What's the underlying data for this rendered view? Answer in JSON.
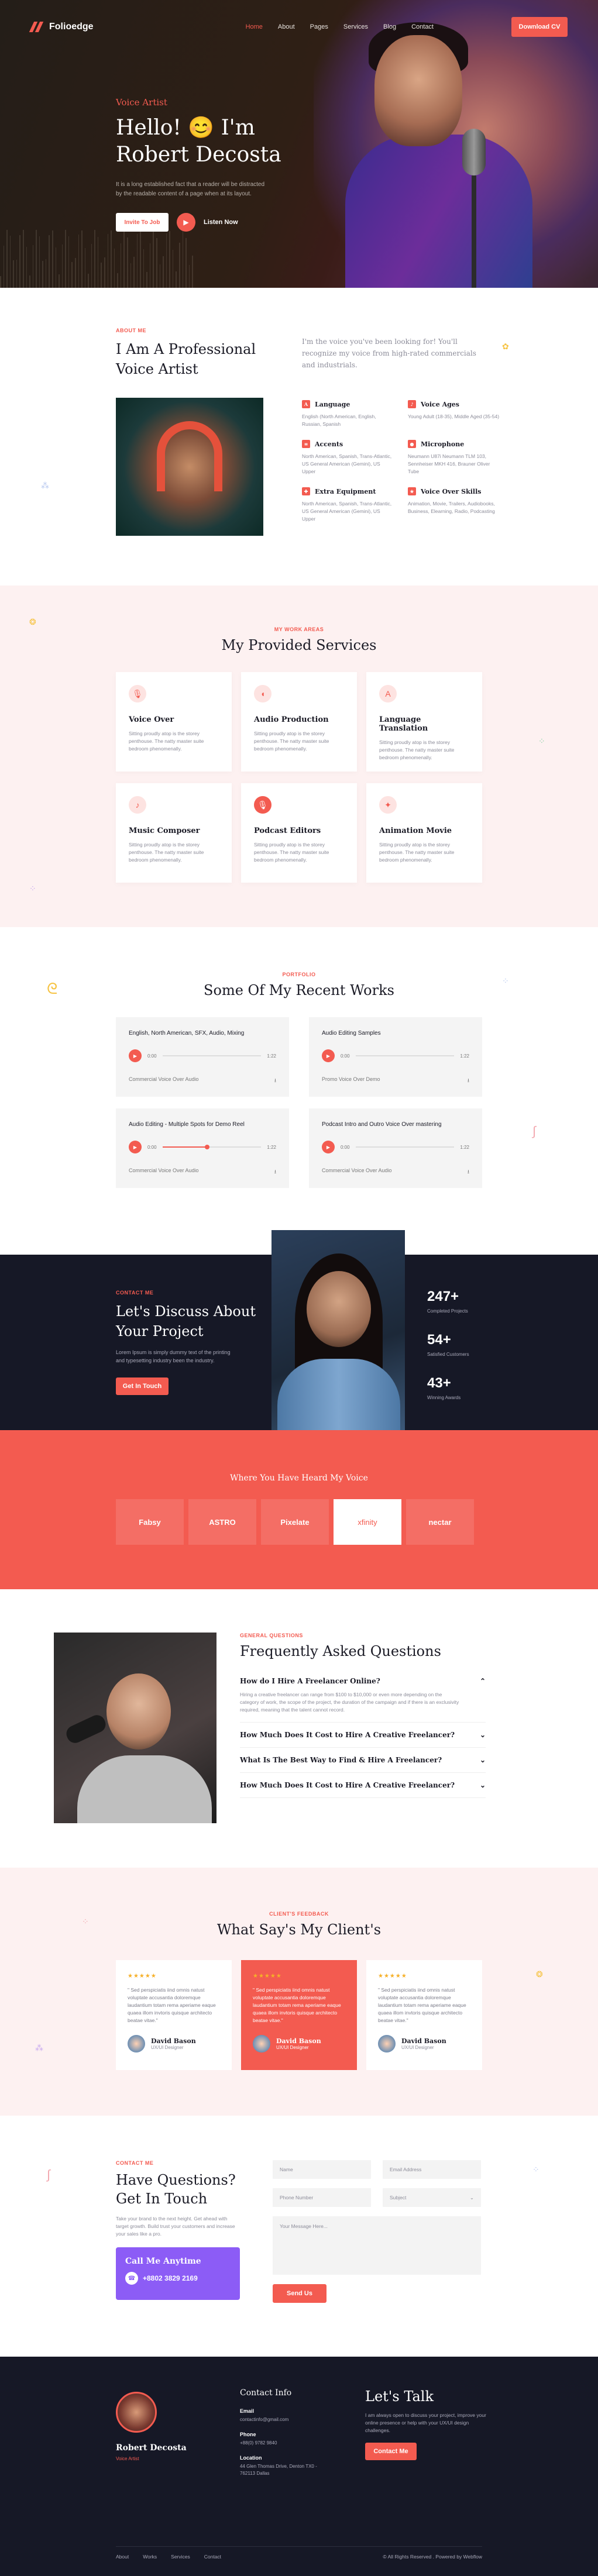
{
  "brand": {
    "name": "Folioedge"
  },
  "nav": {
    "items": [
      {
        "label": "Home"
      },
      {
        "label": "About"
      },
      {
        "label": "Pages"
      },
      {
        "label": "Services"
      },
      {
        "label": "Blog"
      },
      {
        "label": "Contact"
      }
    ],
    "download_label": "Download CV"
  },
  "hero": {
    "tag": "Voice Artist",
    "line1": "Hello! 😊 I'm",
    "line2": "Robert Decosta",
    "desc": "It is a long established fact that a reader will be distracted by the readable content of a page when at its layout.",
    "hire_label": "Invite To Job",
    "listen_label": "Listen Now"
  },
  "about": {
    "tag": "ABOUT ME",
    "title": "I Am A Professional Voice Artist",
    "intro": "I'm the voice you've been looking for! You'll recognize my voice from high-rated commercials and industrials.",
    "facts": [
      {
        "title": "Language",
        "text": "English (North American, English, Russian, Spanish"
      },
      {
        "title": "Voice Ages",
        "text": "Young Adult (18-35), Middle Aged (35-54)"
      },
      {
        "title": "Accents",
        "text": "North American, Spanish, Trans-Atlantic, US General American (Gemini), US Upper"
      },
      {
        "title": "Microphone",
        "text": "Neumann U87i Neumann TLM 103, Sennheiser MKH 416, Brauner Oliver Tube"
      },
      {
        "title": "Extra Equipment",
        "text": "North American, Spanish, Trans-Atlantic, US General American (Gemini), US Upper"
      },
      {
        "title": "Voice Over Skills",
        "text": "Animation, Movie, Trailers, Audiobooks, Business, Elearning, Radio, Podcasting"
      }
    ]
  },
  "services": {
    "tag": "MY WORK AREAS",
    "title": "My Provided Services",
    "items": [
      {
        "title": "Voice Over",
        "text": "Sitting proudly atop is the storey penthouse. The natty master suite bedroom phenomenally."
      },
      {
        "title": "Audio Production",
        "text": "Sitting proudly atop is the storey penthouse. The natty master suite bedroom phenomenally."
      },
      {
        "title": "Language Translation",
        "text": "Sitting proudly atop is the storey penthouse. The natty master suite bedroom phenomenally."
      },
      {
        "title": "Music Composer",
        "text": "Sitting proudly atop is the storey penthouse. The natty master suite bedroom phenomenally."
      },
      {
        "title": "Podcast Editors",
        "text": "Sitting proudly atop is the storey penthouse. The natty master suite bedroom phenomenally."
      },
      {
        "title": "Animation Movie",
        "text": "Sitting proudly atop is the storey penthouse. The natty master suite bedroom phenomenally."
      }
    ]
  },
  "works": {
    "tag": "PORTFOLIO",
    "title": "Some Of My Recent Works",
    "tracks": [
      {
        "title": "English, North American, SFX, Audio, Mixing",
        "start": "0:00",
        "end": "1:22",
        "progress": 0,
        "footer": "Commercial Voice Over Audio"
      },
      {
        "title": "Audio Editing Samples",
        "start": "0:00",
        "end": "1:22",
        "progress": 0,
        "footer": "Promo Voice Over Demo"
      },
      {
        "title": "Audio Editing - Multiple Spots for Demo Reel",
        "start": "0:00",
        "end": "1:22",
        "progress": 0.45,
        "footer": "Commercial Voice Over Audio"
      },
      {
        "title": "Podcast Intro and Outro Voice Over mastering",
        "start": "0:00",
        "end": "1:22",
        "progress": 0,
        "footer": "Commercial Voice Over Audio"
      }
    ]
  },
  "discuss": {
    "tag": "CONTACT ME",
    "title": "Let's Discuss About Your Project",
    "desc": "Lorem Ipsum is simply dummy text of the printing and typesetting industry been the industry.",
    "button": "Get In Touch",
    "stats": [
      {
        "value": "247+",
        "label": "Completed Projects"
      },
      {
        "value": "54+",
        "label": "Satisfied Customers"
      },
      {
        "value": "43+",
        "label": "Winning Awards"
      }
    ]
  },
  "heard": {
    "title": "Where You Have Heard My Voice",
    "brands": [
      {
        "label": "Fabsy"
      },
      {
        "label": "ASTRO"
      },
      {
        "label": "Pixelate"
      },
      {
        "label": "xfinity"
      },
      {
        "label": "nectar"
      }
    ]
  },
  "faq": {
    "tag": "GENERAL QUESTIONS",
    "title": "Frequently Asked Questions",
    "items": [
      {
        "q": "How do I Hire A Freelancer Online?",
        "a": "Hiring a creative freelancer can range from $100 to $10,000 or even more depending on the category of work, the scope of the project, the duration of the campaign and if there is an exclusivity required, meaning that the talent cannot record."
      },
      {
        "q": "How Much Does It Cost to Hire A Creative Freelancer?",
        "a": ""
      },
      {
        "q": "What Is The Best Way to Find & Hire A Freelancer?",
        "a": ""
      },
      {
        "q": "How Much Does It Cost to Hire A Creative Freelancer?",
        "a": ""
      }
    ]
  },
  "testimonials": {
    "tag": "CLIENT'S FEEDBACK",
    "title": "What Say's My Client's",
    "items": [
      {
        "text": "\" Sed perspiciatis iind omnis natust voluptate accusantia doloremque laudantium totam rema aperiame eaque quaea illom invtoris quisque architecto beatae vitae.\"",
        "name": "David Bason",
        "role": "UX/UI Designer"
      },
      {
        "text": "\" Sed perspiciatis iind omnis natust voluptate accusantia doloremque laudantium totam rema aperiame eaque quaea illom invtoris quisque architecto beatae vitae.\"",
        "name": "David Bason",
        "role": "UX/UI Designer"
      },
      {
        "text": "\" Sed perspiciatis iind omnis natust voluptate accusantia doloremque laudantium totam rema aperiame eaque quaea illom invtoris quisque architecto beatae vitae.\"",
        "name": "David Bason",
        "role": "UX/UI Designer"
      }
    ]
  },
  "questions": {
    "tag": "CONTACT ME",
    "title": "Have Questions? Get In Touch",
    "desc": "Take your brand to the next height. Get ahead with target growth. Build trust your customers and increase your sales like a pro.",
    "call_title": "Call Me Anytime",
    "phone": "+8802 3829 2169",
    "fields": {
      "name": "Name",
      "email": "Email Address",
      "phone": "Phone Number",
      "subject": "Subject",
      "message": "Your Message Here..."
    },
    "send": "Send Us"
  },
  "footer": {
    "name": "Robert Decosta",
    "role": "Voice Artist",
    "info_title": "Contact Info",
    "email_label": "Email",
    "email": "contactinfo@gmail.com",
    "phone_label": "Phone",
    "phone": "+88(0) 9782 9840",
    "location_label": "Location",
    "location": "44 Glen Thomas Drive, Denton TX0 - 762113 Dallas",
    "talk_title": "Let's Talk",
    "talk_desc": "I am always open to discuss your project, improve your online presence or help with your UX/UI design challenges.",
    "contact_button": "Contact Me",
    "links": [
      {
        "label": "About"
      },
      {
        "label": "Works"
      },
      {
        "label": "Services"
      },
      {
        "label": "Contact"
      }
    ],
    "copyright": "© All Rights Reserved . Powered by Webflow"
  }
}
